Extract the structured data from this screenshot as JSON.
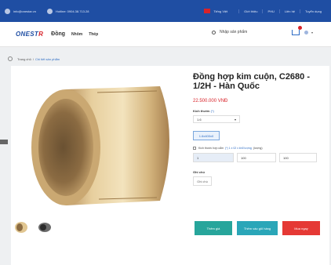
{
  "topbar": {
    "email": "info@onestar.vn",
    "hotline": "Hotline: 0904.38.713.28",
    "language": "Tiếng Việt",
    "links": [
      "Giới thiệu",
      "PHU",
      "Liên hệ",
      "Tuyển dụng"
    ]
  },
  "header": {
    "logo_main": "ONEST",
    "logo_accent": "R",
    "nav": [
      "Đồng",
      "Nhôm",
      "Thép"
    ],
    "search_placeholder": "Nhập sản phẩm",
    "cart_icon": "cart-icon",
    "user_icon": "user-icon"
  },
  "breadcrumb": {
    "home": "Trang chủ",
    "separator": "/",
    "current": "Chi tiết sản phẩm"
  },
  "product": {
    "title": "Đồng hợp kim cuộn, C2680 - 1/2H - Hàn Quốc",
    "price": "22.500.000 VNĐ",
    "size_label": "Kích thước",
    "size_sub": "(*)",
    "size_value": "1.6",
    "chip": "1.6x400x0",
    "custom_label_a": "Kích thước hợp cắm",
    "custom_label_link": "(*) 1 x 02 x khổ lượng",
    "custom_label_b": "(lượng)",
    "dims": [
      "1",
      "100",
      "100"
    ],
    "note_label": "Ghi chú",
    "note_value": "Ghi chú"
  },
  "buttons": {
    "quote": "Thêm giá",
    "add_cart": "Thêm vào giỏ hàng",
    "buy_now": "Mua ngay"
  },
  "colors": {
    "topbar": "#1f4ea3",
    "price": "#d8232a",
    "btn_green": "#27a59b",
    "btn_teal": "#2aa6b8",
    "btn_red": "#e53935"
  }
}
